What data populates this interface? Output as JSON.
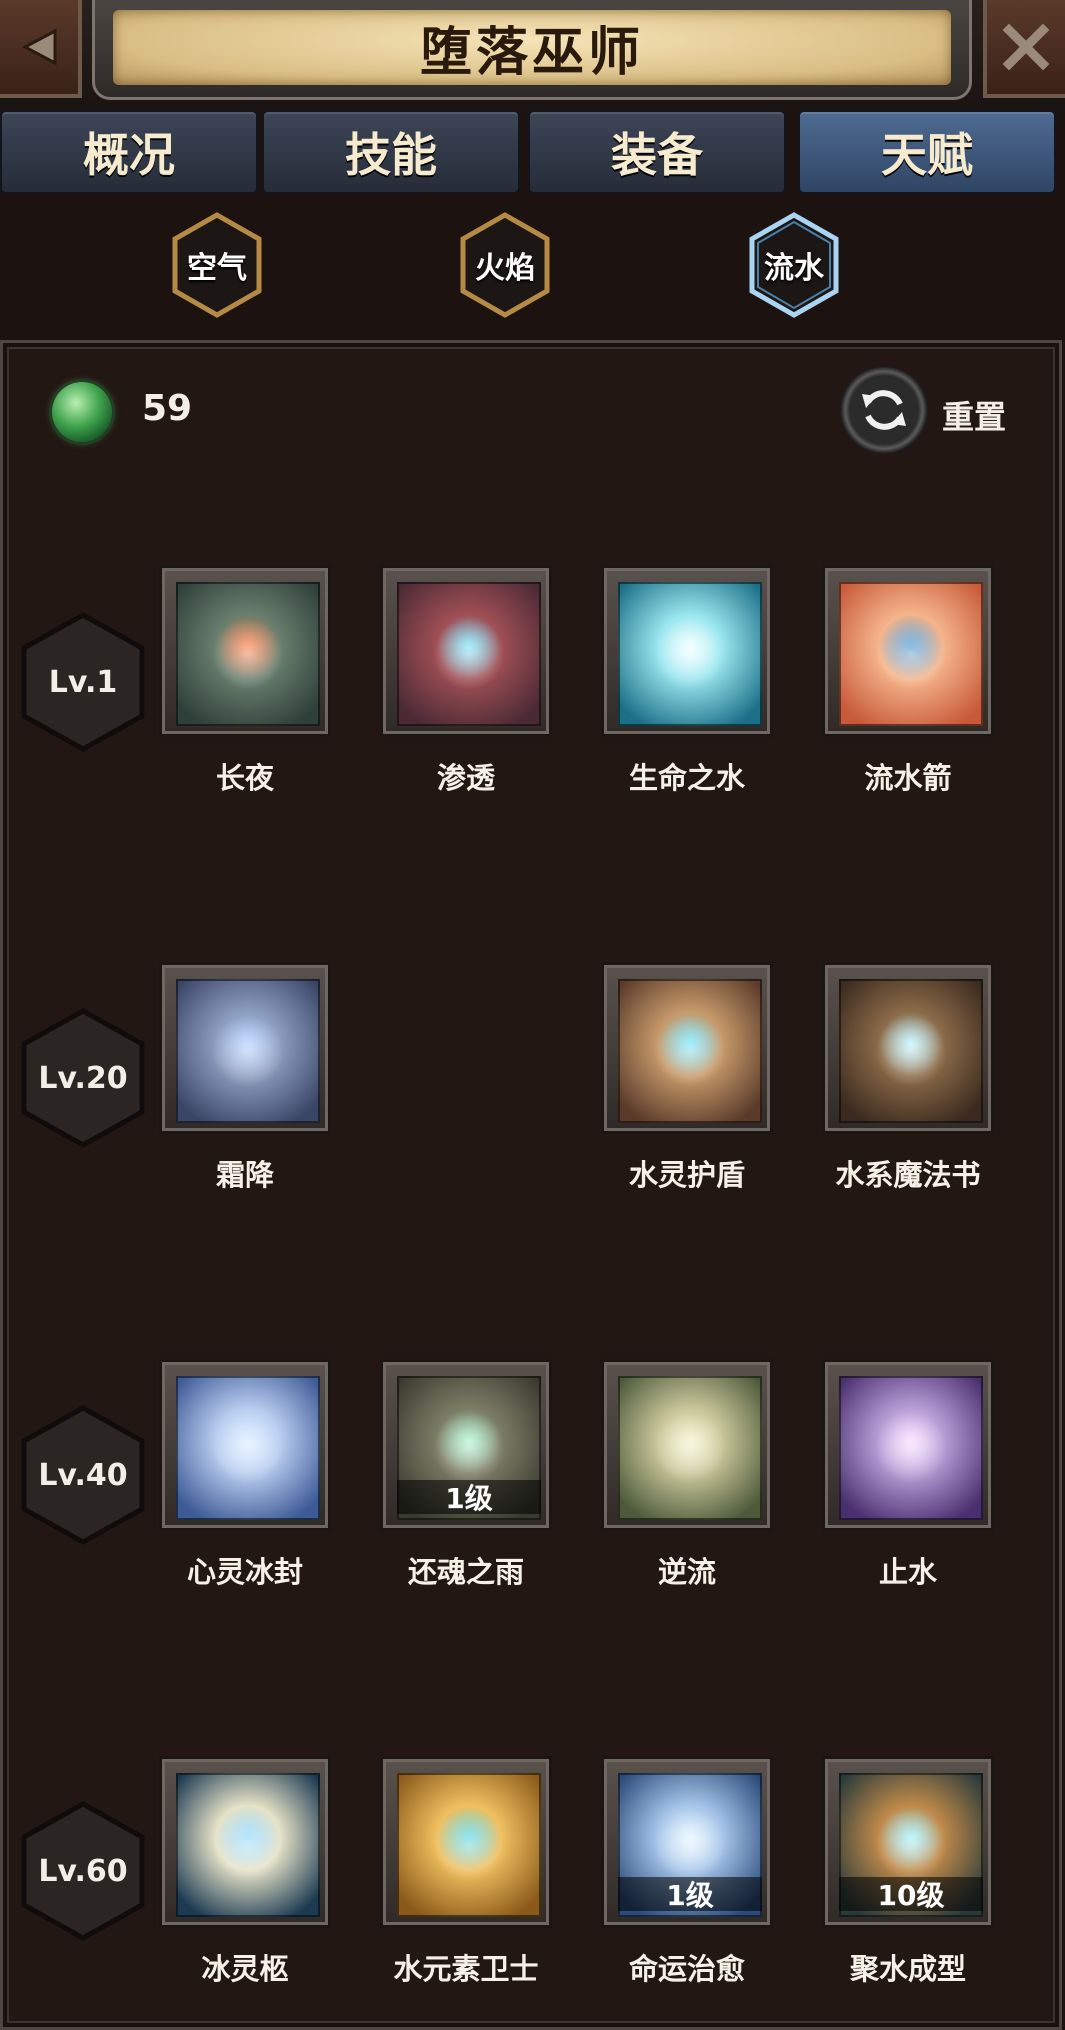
{
  "header": {
    "title": "堕落巫师",
    "back_icon": "back-arrow-icon",
    "close_icon": "close-x-icon"
  },
  "tabs": [
    {
      "label": "概况",
      "active": false
    },
    {
      "label": "技能",
      "active": false
    },
    {
      "label": "装备",
      "active": false
    },
    {
      "label": "天赋",
      "active": true
    }
  ],
  "elements": [
    {
      "label": "空气",
      "selected": false
    },
    {
      "label": "火焰",
      "selected": false
    },
    {
      "label": "流水",
      "selected": true
    }
  ],
  "points": {
    "value": "59",
    "icon": "green-orb-icon"
  },
  "reset": {
    "label": "重置",
    "icon": "refresh-icon"
  },
  "tiers": [
    {
      "level": "Lv.1",
      "talents": [
        {
          "name": "长夜",
          "badge": "",
          "colors": [
            "#2f3f3a",
            "#6a7f6e"
          ],
          "glow": "#ff6a2a"
        },
        {
          "name": "渗透",
          "badge": "",
          "colors": [
            "#4a2a35",
            "#a04f55"
          ],
          "glow": "#5fe3ff"
        },
        {
          "name": "生命之水",
          "badge": "",
          "colors": [
            "#1b6f86",
            "#9ae6ef"
          ],
          "glow": "#e8ffff"
        },
        {
          "name": "流水箭",
          "badge": "",
          "colors": [
            "#c85a3a",
            "#f5b58b"
          ],
          "glow": "#2a8ad4"
        }
      ]
    },
    {
      "level": "Lv.20",
      "talents": [
        {
          "name": "霜降",
          "badge": "",
          "colors": [
            "#3a4566",
            "#8d9dbf"
          ],
          "glow": "#9fc4ff"
        },
        null,
        {
          "name": "水灵护盾",
          "badge": "",
          "colors": [
            "#5a3b2a",
            "#c79a6a"
          ],
          "glow": "#58e1ff"
        },
        {
          "name": "水系魔法书",
          "badge": "",
          "colors": [
            "#3a2a1f",
            "#8c6b48"
          ],
          "glow": "#aef2ff"
        }
      ]
    },
    {
      "level": "Lv.40",
      "talents": [
        {
          "name": "心灵冰封",
          "badge": "",
          "colors": [
            "#3c5a94",
            "#b9cdf0"
          ],
          "glow": "#cfe8ff"
        },
        {
          "name": "还魂之雨",
          "badge": "1级",
          "colors": [
            "#3a3a30",
            "#7c7d66"
          ],
          "glow": "#9bf2c4"
        },
        {
          "name": "逆流",
          "badge": "",
          "colors": [
            "#4d5a3a",
            "#c9c79a"
          ],
          "glow": "#f0efc0"
        },
        {
          "name": "止水",
          "badge": "",
          "colors": [
            "#4a2f6e",
            "#b79fd6"
          ],
          "glow": "#f7d3ff"
        }
      ]
    },
    {
      "level": "Lv.60",
      "talents": [
        {
          "name": "冰灵柩",
          "badge": "",
          "colors": [
            "#1c3a52",
            "#e6e3c8"
          ],
          "glow": "#7fd3ff"
        },
        {
          "name": "水元素卫士",
          "badge": "",
          "colors": [
            "#8a5a1a",
            "#f0c060"
          ],
          "glow": "#3ad1e8"
        },
        {
          "name": "命运治愈",
          "badge": "1级",
          "colors": [
            "#2a4a7a",
            "#a7c6ea"
          ],
          "glow": "#e0f2ff"
        },
        {
          "name": "聚水成型",
          "badge": "10级",
          "colors": [
            "#2a3a3a",
            "#c08a4a"
          ],
          "glow": "#8af0ff"
        }
      ]
    }
  ]
}
